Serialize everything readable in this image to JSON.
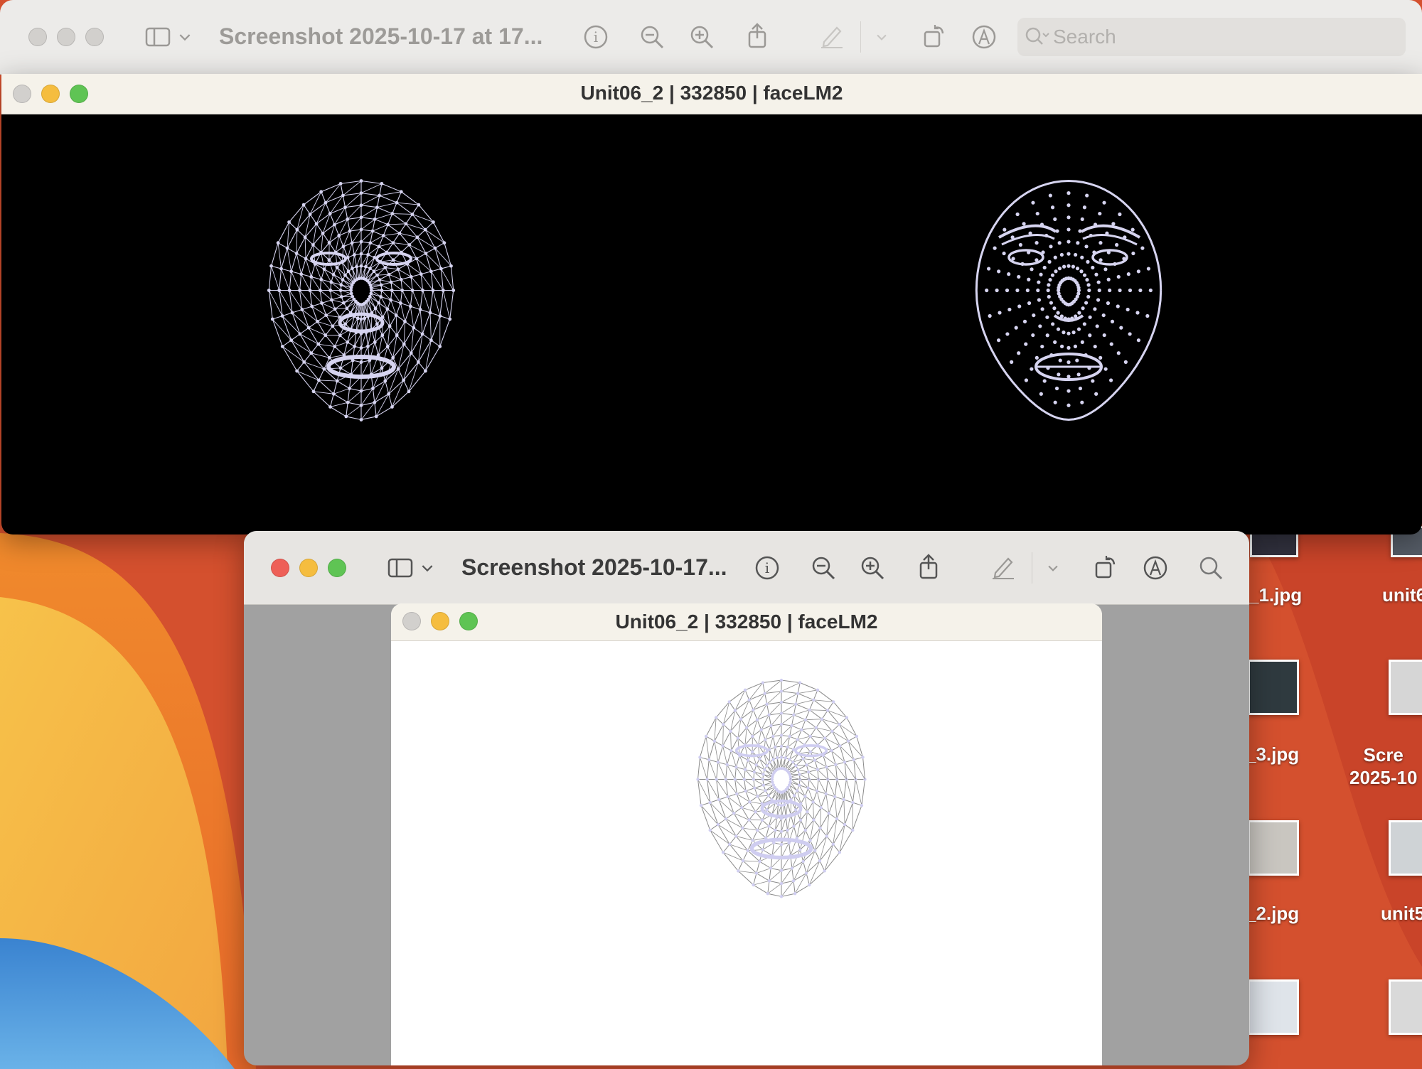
{
  "back_preview": {
    "title": "Screenshot 2025-10-17 at 17...",
    "search_placeholder": "Search",
    "icons": [
      "sidebar-icon",
      "chevron-down-icon",
      "info-icon",
      "zoom-out-icon",
      "zoom-in-icon",
      "share-icon",
      "markup-pen-icon",
      "chevron-down-icon",
      "rotate-icon",
      "annotate-icon",
      "search-icon"
    ]
  },
  "black_window": {
    "title": "Unit06_2 | 332850 | faceLM2",
    "left_face": "face mesh wireframe",
    "right_face": "face landmarks dots"
  },
  "front_preview": {
    "title": "Screenshot 2025-10-17...",
    "icons": [
      "sidebar-icon",
      "chevron-down-icon",
      "info-icon",
      "zoom-out-icon",
      "zoom-in-icon",
      "share-icon",
      "markup-pen-icon",
      "chevron-down-icon",
      "rotate-icon",
      "annotate-icon",
      "search-icon"
    ]
  },
  "white_window": {
    "title": "Unit06_2 | 332850 | faceLM2"
  },
  "desktop": {
    "files": [
      {
        "label": "_1.jpg"
      },
      {
        "label": "unit6"
      },
      {
        "label": "_3.jpg"
      },
      {
        "label": "Scre\n2025-10"
      },
      {
        "label": "_2.jpg"
      },
      {
        "label": "unit5"
      }
    ]
  },
  "colors": {
    "close": "#ee5f57",
    "minimize": "#f5bd3f",
    "zoom": "#5fc454",
    "inactive": "#d2d0cd",
    "mesh": "#d6d4f0"
  }
}
